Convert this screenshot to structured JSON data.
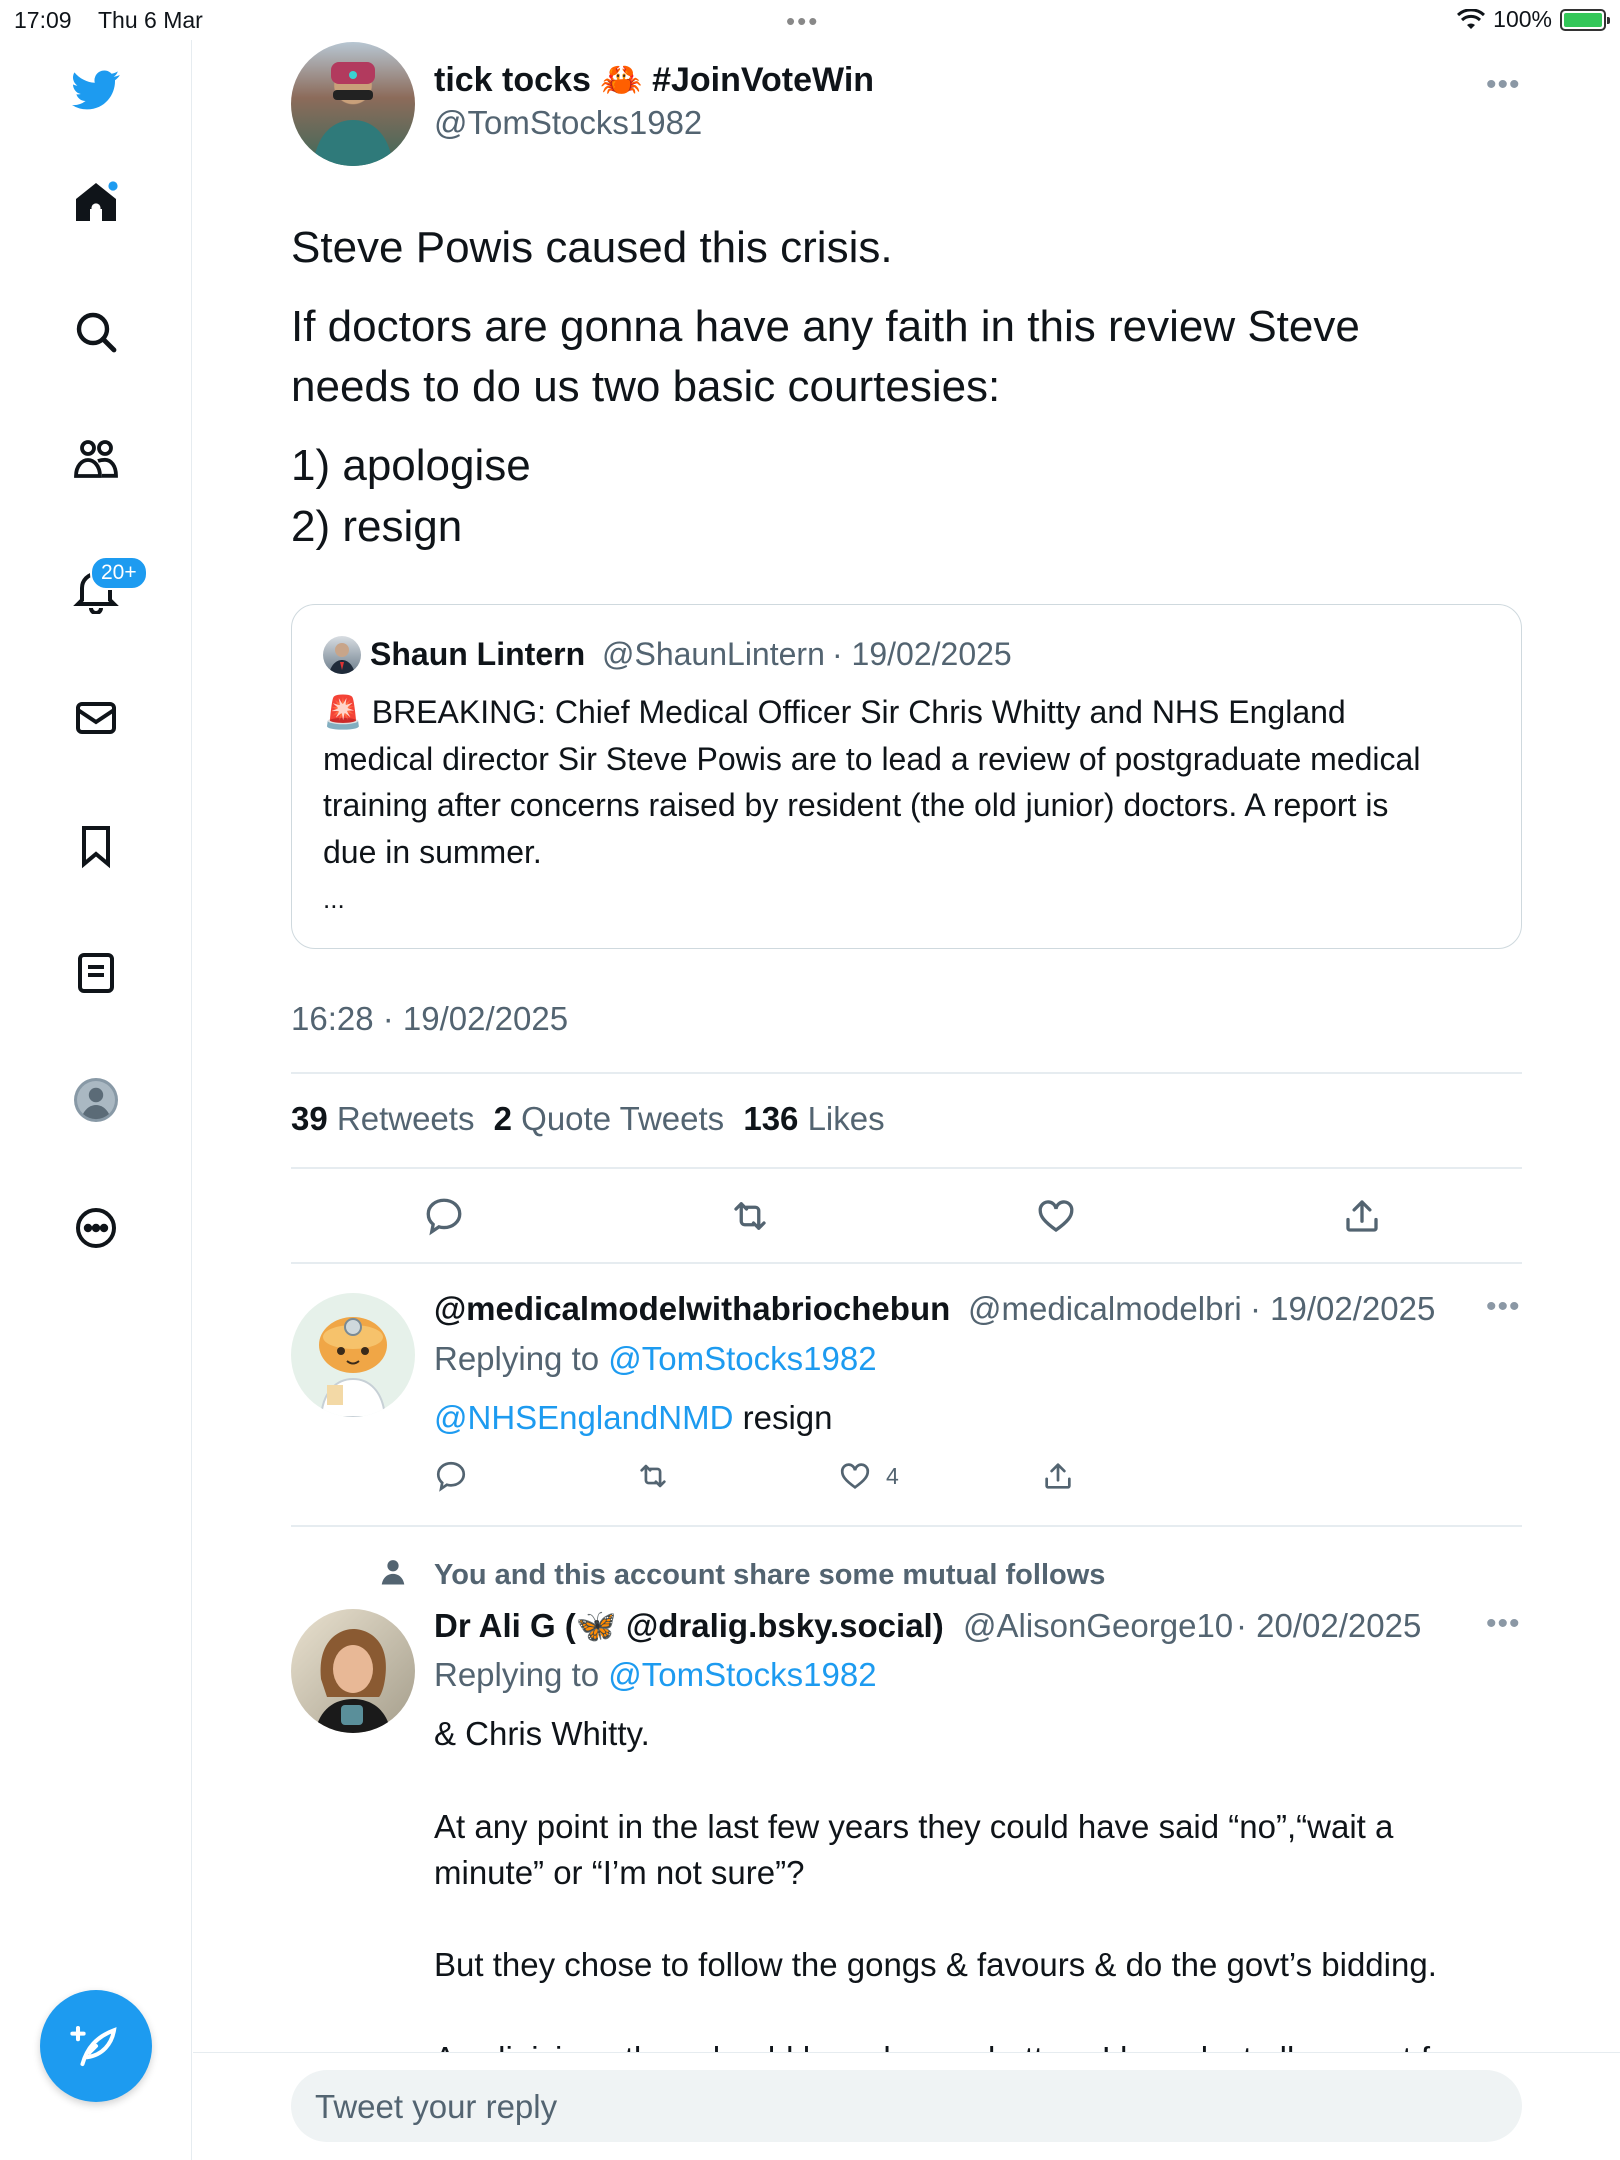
{
  "status_bar": {
    "time": "17:09",
    "date": "Thu 6 Mar",
    "battery": "100%",
    "battery_level": 1.0
  },
  "sidebar": {
    "items": [
      {
        "name": "twitter-logo",
        "icon": "twitter-bird-icon"
      },
      {
        "name": "home",
        "icon": "home-icon"
      },
      {
        "name": "explore",
        "icon": "search-icon"
      },
      {
        "name": "communities",
        "icon": "people-icon"
      },
      {
        "name": "notifications",
        "icon": "bell-icon",
        "badge": "20+"
      },
      {
        "name": "messages",
        "icon": "mail-icon"
      },
      {
        "name": "bookmarks",
        "icon": "bookmark-icon"
      },
      {
        "name": "lists",
        "icon": "list-icon"
      },
      {
        "name": "profile",
        "icon": "profile-icon"
      },
      {
        "name": "more",
        "icon": "more-circle-icon"
      }
    ],
    "compose_icon": "compose-tweet-icon"
  },
  "tweet": {
    "author_name": "tick tocks 🦀 #JoinVoteWin",
    "author_handle": "@TomStocks1982",
    "text_lines": [
      "Steve Powis caused this crisis.",
      "If doctors are gonna have any faith in this review Steve",
      "needs to do us two basic courtesies:",
      "1) apologise",
      "2) resign"
    ],
    "quote": {
      "name": "Shaun Lintern",
      "handle": "@ShaunLintern",
      "date": "· 19/02/2025",
      "lines": [
        "🚨 BREAKING: Chief Medical Officer Sir Chris Whitty and NHS England",
        "medical director Sir Steve Powis are to lead a review of postgraduate medical",
        "training after concerns raised by resident (the old junior) doctors. A report is",
        "due in summer.",
        "..."
      ]
    },
    "timestamp": "16:28 · 19/02/2025",
    "stats": {
      "retweets_count": "39",
      "retweets_label": "Retweets",
      "quotes_count": "2",
      "quotes_label": "Quote Tweets",
      "likes_count": "136",
      "likes_label": "Likes"
    }
  },
  "replies": [
    {
      "name": "@medicalmodelwithabriochebun",
      "handle": "@medicalmodelbri",
      "date": "· 19/02/2025",
      "replying_prefix": "Replying to",
      "replying_to": "@TomStocks1982",
      "mention": "@NHSEnglandNMD",
      "text": "resign",
      "likes": "4"
    },
    {
      "mutual_note": "You and this account share some mutual follows",
      "name": "Dr Ali G (🦋 @dralig.bsky.social)",
      "handle": "@AlisonGeorge10",
      "date": "· 20/02/2025",
      "replying_prefix": "Replying to",
      "replying_to": "@TomStocks1982",
      "paragraphs": [
        "& Chris Whitty.",
        "At any point in the last few years they could have said “no”,“wait a",
        "minute” or “I’m not sure”?",
        "But they chose to follow the gongs & favours & do the govt’s bidding.",
        "As clinicians they should have known better - I have lost all respect for"
      ]
    }
  ],
  "reply_box": {
    "placeholder": "Tweet your reply"
  },
  "colors": {
    "accent": "#1d9bf0",
    "muted": "#536471",
    "text": "#0f1419",
    "divider": "#e6ecf0"
  }
}
